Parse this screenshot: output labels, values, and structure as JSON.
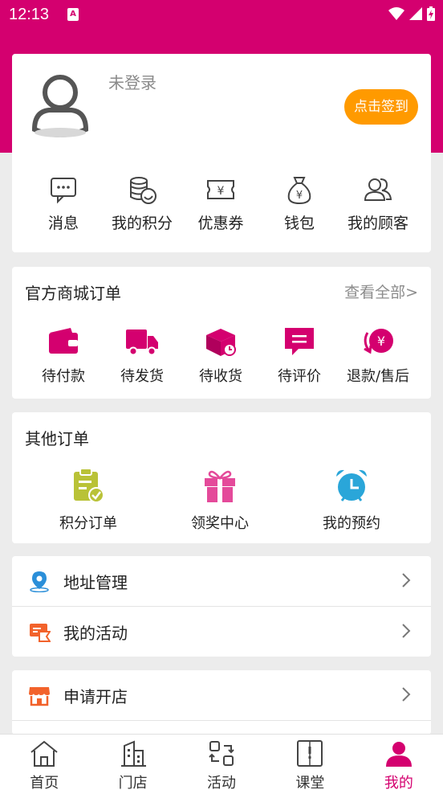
{
  "status_bar": {
    "time": "12:13",
    "app_icon_letter": "A"
  },
  "profile": {
    "login_status": "未登录",
    "signin_button": "点击签到",
    "quick_links": [
      {
        "label": "消息",
        "icon": "message-icon"
      },
      {
        "label": "我的积分",
        "icon": "points-coins-icon"
      },
      {
        "label": "优惠券",
        "icon": "coupon-icon"
      },
      {
        "label": "钱包",
        "icon": "wallet-bag-icon"
      },
      {
        "label": "我的顾客",
        "icon": "customers-icon"
      }
    ]
  },
  "official_orders": {
    "title": "官方商城订单",
    "view_all": "查看全部>",
    "items": [
      {
        "label": "待付款",
        "icon": "wallet-icon"
      },
      {
        "label": "待发货",
        "icon": "truck-icon"
      },
      {
        "label": "待收货",
        "icon": "package-icon"
      },
      {
        "label": "待评价",
        "icon": "review-icon"
      },
      {
        "label": "退款/售后",
        "icon": "refund-icon"
      }
    ]
  },
  "other_orders": {
    "title": "其他订单",
    "items": [
      {
        "label": "积分订单",
        "icon": "clipboard-check-icon"
      },
      {
        "label": "领奖中心",
        "icon": "gift-icon"
      },
      {
        "label": "我的预约",
        "icon": "alarm-clock-icon"
      }
    ]
  },
  "menu": {
    "address": "地址管理",
    "activities": "我的活动",
    "open_store": "申请开店"
  },
  "tabbar": {
    "items": [
      {
        "label": "首页",
        "icon": "home-icon"
      },
      {
        "label": "门店",
        "icon": "store-building-icon"
      },
      {
        "label": "活动",
        "icon": "activity-icon"
      },
      {
        "label": "课堂",
        "icon": "book-icon"
      },
      {
        "label": "我的",
        "icon": "profile-icon",
        "active": true
      }
    ]
  },
  "colors": {
    "brand": "#d4006f",
    "signin": "#ff9a00",
    "gift": "#e44a9a",
    "alarm": "#2aa6d9",
    "clipboard": "#b9c237",
    "address_pin": "#2b8fd9",
    "activity": "#f2622b",
    "store": "#f2622b"
  }
}
